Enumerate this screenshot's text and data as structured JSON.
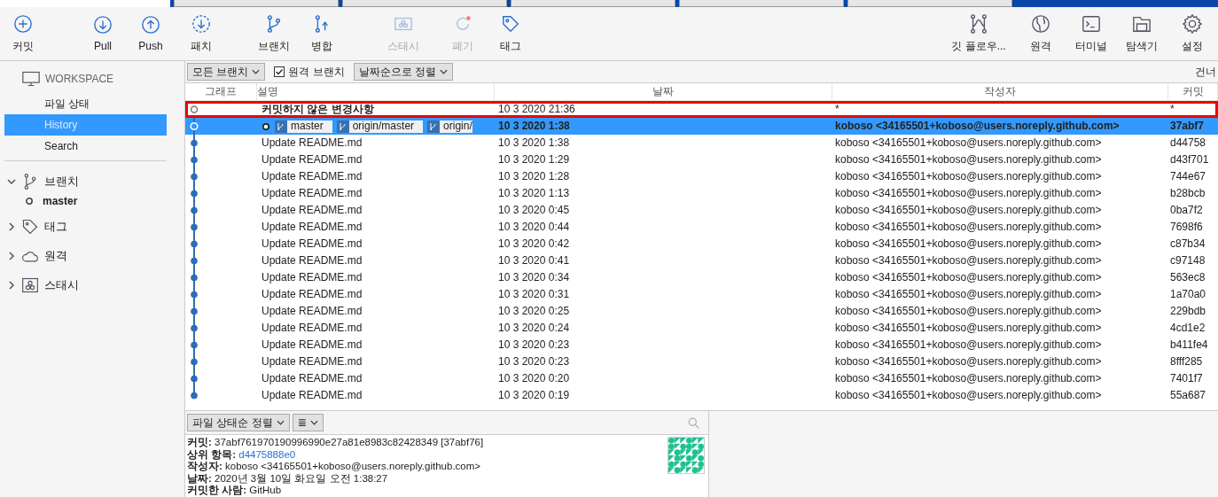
{
  "tabs": [
    {
      "selected": true
    },
    {
      "selected": false
    },
    {
      "selected": false
    },
    {
      "selected": false
    },
    {
      "selected": false
    },
    {
      "selected": false
    }
  ],
  "toolbar": {
    "left": [
      {
        "kind": "plus",
        "label": "커밋",
        "disabled": false
      },
      {
        "kind": "down",
        "label": "Pull",
        "disabled": false
      },
      {
        "kind": "up",
        "label": "Push",
        "disabled": false
      },
      {
        "kind": "fetch",
        "label": "패치",
        "disabled": false
      },
      {
        "kind": "branch",
        "label": "브랜치",
        "disabled": false
      },
      {
        "kind": "merge",
        "label": "병합",
        "disabled": false
      },
      {
        "kind": "stash",
        "label": "스태시",
        "disabled": true
      },
      {
        "kind": "discard",
        "label": "폐기",
        "disabled": true
      },
      {
        "kind": "tag",
        "label": "태그",
        "disabled": false
      }
    ],
    "right": [
      {
        "kind": "flow",
        "label": "깃 플로우...",
        "disabled": false
      },
      {
        "kind": "globe",
        "label": "원격",
        "disabled": false
      },
      {
        "kind": "terminal",
        "label": "터미널",
        "disabled": false
      },
      {
        "kind": "folder",
        "label": "탐색기",
        "disabled": false
      },
      {
        "kind": "gear",
        "label": "설정",
        "disabled": false
      }
    ]
  },
  "sidebar": {
    "workspace": {
      "title": "WORKSPACE",
      "items": [
        {
          "label": "파일 상태",
          "selected": false
        },
        {
          "label": "History",
          "selected": true
        },
        {
          "label": "Search",
          "selected": false
        }
      ]
    },
    "groups": [
      {
        "kind": "branch",
        "label": "브랜치",
        "expanded": true,
        "children": [
          {
            "label": "master",
            "current": true
          }
        ]
      },
      {
        "kind": "tag",
        "label": "태그",
        "expanded": false
      },
      {
        "kind": "cloud",
        "label": "원격",
        "expanded": false
      },
      {
        "kind": "stash",
        "label": "스태시",
        "expanded": false
      }
    ]
  },
  "filter_bar": {
    "branch_dropdown": "모든 브랜치",
    "remote_branches": {
      "label": "원격 브랜치",
      "checked": true
    },
    "sort_dropdown": "날짜순으로 정렬",
    "skip": "건너"
  },
  "table": {
    "columns": [
      "그래프",
      "설명",
      "날짜",
      "작성자",
      "커밋"
    ],
    "rows": [
      {
        "kind": "uncommitted",
        "selected": false,
        "highlighted": true,
        "description": "커밋하지 않은 변경사항",
        "refs": [],
        "date": "10 3 2020 21:36",
        "author": "*",
        "commit": "*"
      },
      {
        "kind": "commit",
        "selected": true,
        "highlighted": false,
        "description": "",
        "refs": [
          "master",
          "origin/master",
          "origin/"
        ],
        "date": "10 3 2020 1:38",
        "author": "koboso <34165501+koboso@users.noreply.github.com>",
        "commit": "37abf7"
      },
      {
        "kind": "commit",
        "selected": false,
        "highlighted": false,
        "description": "Update README.md",
        "refs": [],
        "date": "10 3 2020 1:38",
        "author": "koboso <34165501+koboso@users.noreply.github.com>",
        "commit": "d44758"
      },
      {
        "kind": "commit",
        "selected": false,
        "highlighted": false,
        "description": "Update README.md",
        "refs": [],
        "date": "10 3 2020 1:29",
        "author": "koboso <34165501+koboso@users.noreply.github.com>",
        "commit": "d43f701"
      },
      {
        "kind": "commit",
        "selected": false,
        "highlighted": false,
        "description": "Update README.md",
        "refs": [],
        "date": "10 3 2020 1:28",
        "author": "koboso <34165501+koboso@users.noreply.github.com>",
        "commit": "744e67"
      },
      {
        "kind": "commit",
        "selected": false,
        "highlighted": false,
        "description": "Update README.md",
        "refs": [],
        "date": "10 3 2020 1:13",
        "author": "koboso <34165501+koboso@users.noreply.github.com>",
        "commit": "b28bcb"
      },
      {
        "kind": "commit",
        "selected": false,
        "highlighted": false,
        "description": "Update README.md",
        "refs": [],
        "date": "10 3 2020 0:45",
        "author": "koboso <34165501+koboso@users.noreply.github.com>",
        "commit": "0ba7f2"
      },
      {
        "kind": "commit",
        "selected": false,
        "highlighted": false,
        "description": "Update README.md",
        "refs": [],
        "date": "10 3 2020 0:44",
        "author": "koboso <34165501+koboso@users.noreply.github.com>",
        "commit": "7698f6"
      },
      {
        "kind": "commit",
        "selected": false,
        "highlighted": false,
        "description": "Update README.md",
        "refs": [],
        "date": "10 3 2020 0:42",
        "author": "koboso <34165501+koboso@users.noreply.github.com>",
        "commit": "c87b34"
      },
      {
        "kind": "commit",
        "selected": false,
        "highlighted": false,
        "description": "Update README.md",
        "refs": [],
        "date": "10 3 2020 0:41",
        "author": "koboso <34165501+koboso@users.noreply.github.com>",
        "commit": "c97148"
      },
      {
        "kind": "commit",
        "selected": false,
        "highlighted": false,
        "description": "Update README.md",
        "refs": [],
        "date": "10 3 2020 0:34",
        "author": "koboso <34165501+koboso@users.noreply.github.com>",
        "commit": "563ec8"
      },
      {
        "kind": "commit",
        "selected": false,
        "highlighted": false,
        "description": "Update README.md",
        "refs": [],
        "date": "10 3 2020 0:31",
        "author": "koboso <34165501+koboso@users.noreply.github.com>",
        "commit": "1a70a0"
      },
      {
        "kind": "commit",
        "selected": false,
        "highlighted": false,
        "description": "Update README.md",
        "refs": [],
        "date": "10 3 2020 0:25",
        "author": "koboso <34165501+koboso@users.noreply.github.com>",
        "commit": "229bdb"
      },
      {
        "kind": "commit",
        "selected": false,
        "highlighted": false,
        "description": "Update README.md",
        "refs": [],
        "date": "10 3 2020 0:24",
        "author": "koboso <34165501+koboso@users.noreply.github.com>",
        "commit": "4cd1e2"
      },
      {
        "kind": "commit",
        "selected": false,
        "highlighted": false,
        "description": "Update README.md",
        "refs": [],
        "date": "10 3 2020 0:23",
        "author": "koboso <34165501+koboso@users.noreply.github.com>",
        "commit": "b411fe4"
      },
      {
        "kind": "commit",
        "selected": false,
        "highlighted": false,
        "description": "Update README.md",
        "refs": [],
        "date": "10 3 2020 0:23",
        "author": "koboso <34165501+koboso@users.noreply.github.com>",
        "commit": "8fff285"
      },
      {
        "kind": "commit",
        "selected": false,
        "highlighted": false,
        "description": "Update README.md",
        "refs": [],
        "date": "10 3 2020 0:20",
        "author": "koboso <34165501+koboso@users.noreply.github.com>",
        "commit": "7401f7"
      },
      {
        "kind": "commit",
        "selected": false,
        "highlighted": false,
        "description": "Update README.md",
        "refs": [],
        "date": "10 3 2020 0:19",
        "author": "koboso <34165501+koboso@users.noreply.github.com>",
        "commit": "55a687"
      }
    ]
  },
  "details": {
    "sort_dropdown": "파일 상태순 정렬",
    "view_dropdown": "≣",
    "lines": [
      {
        "label": "커밋:",
        "value": "37abf761970190996990e27a81e8983c82428349 [37abf76]",
        "link": false
      },
      {
        "label": "상위 항목:",
        "value": "d4475888e0",
        "link": true
      },
      {
        "label": "작성자:",
        "value": "koboso <34165501+koboso@users.noreply.github.com>",
        "link": false
      },
      {
        "label": "날짜:",
        "value": "2020년 3월 10일 화요일 오전 1:38:27",
        "link": false
      },
      {
        "label": "커밋한 사람:",
        "value": "GitHub",
        "link": false
      }
    ]
  }
}
